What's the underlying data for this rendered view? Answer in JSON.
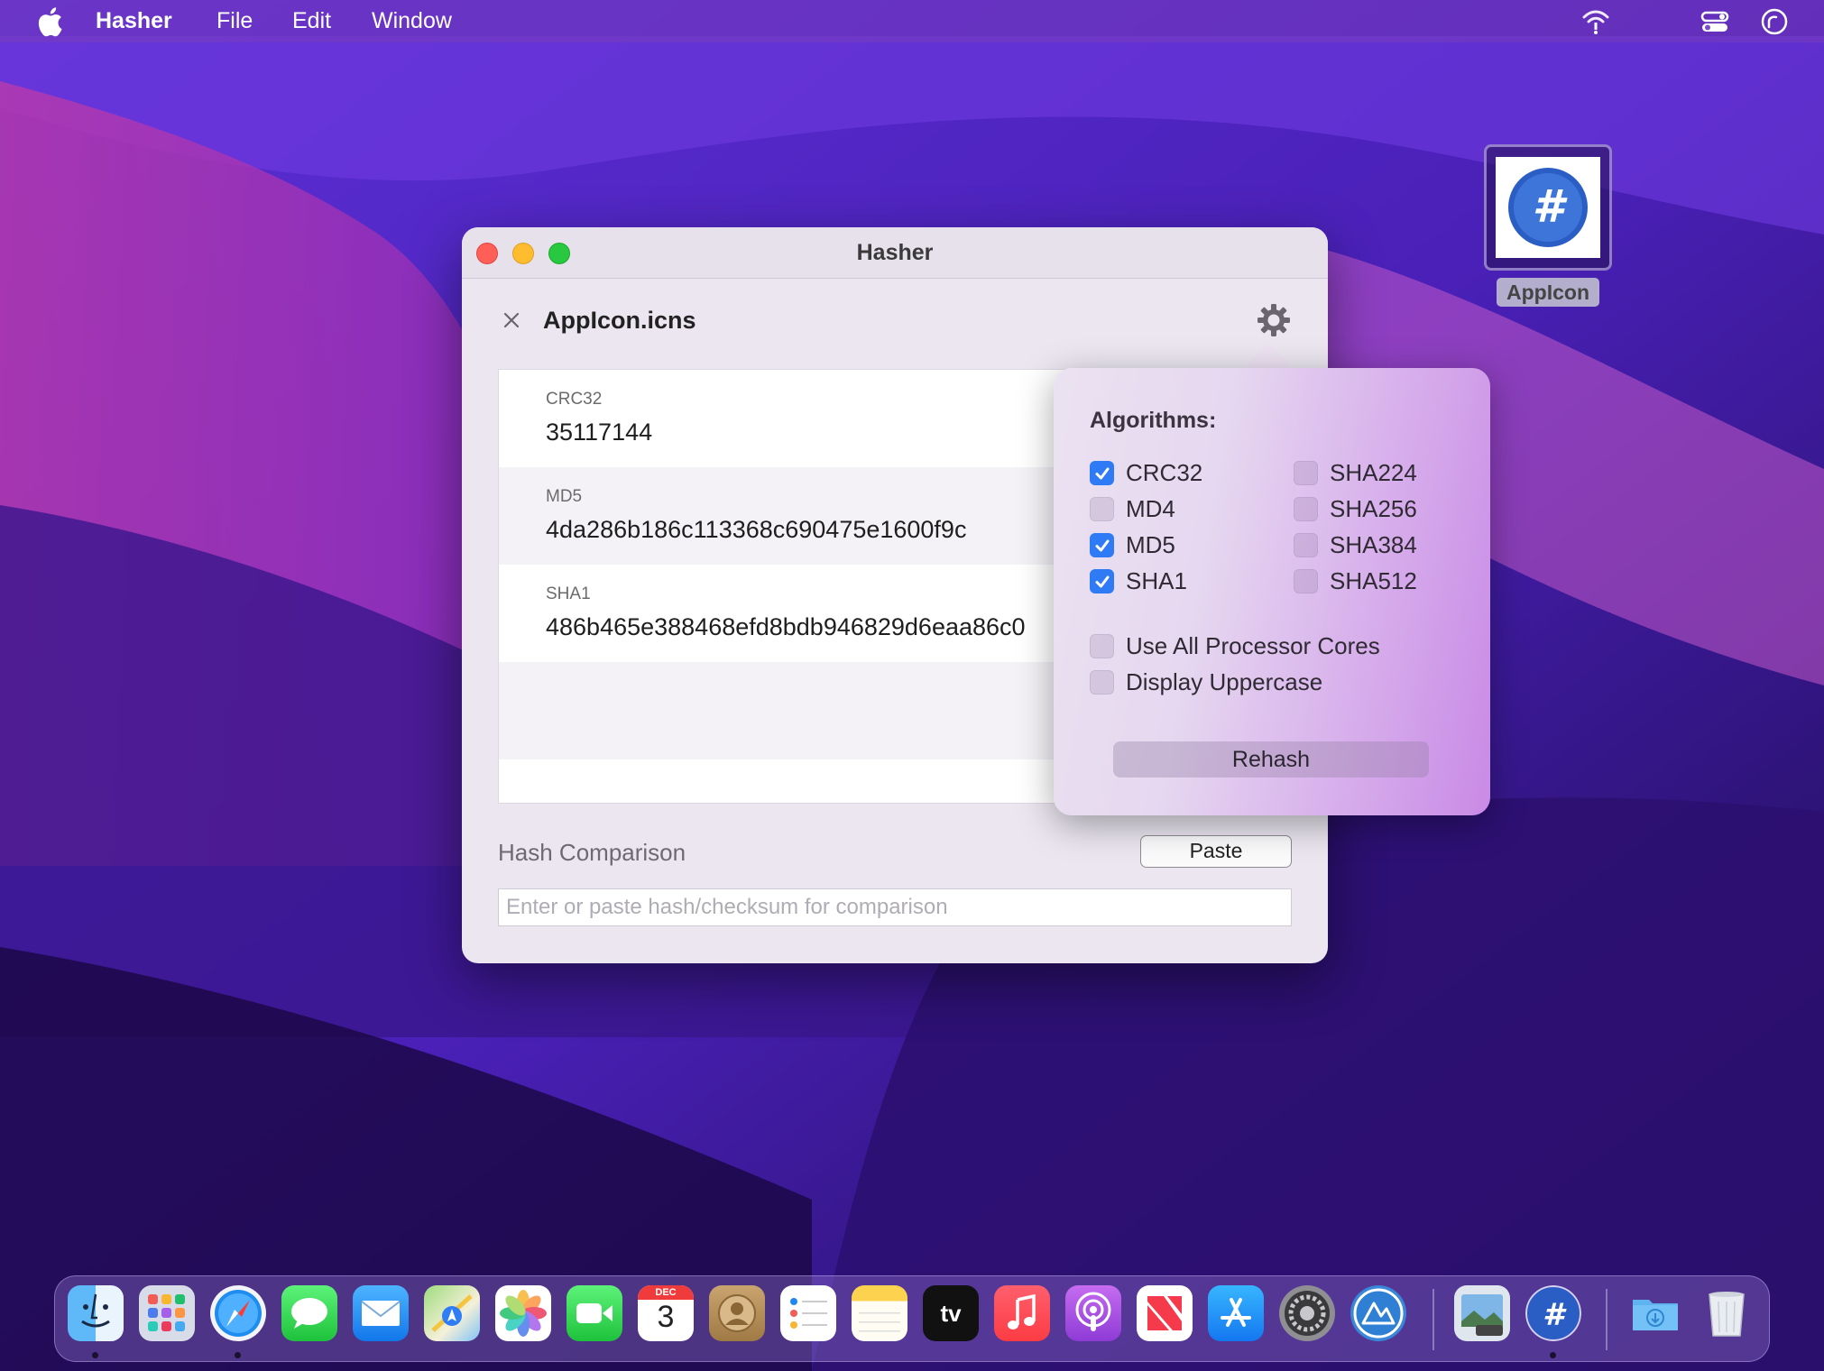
{
  "menubar": {
    "app_name": "Hasher",
    "menus": [
      "File",
      "Edit",
      "Window"
    ]
  },
  "desktop": {
    "icon_label": "AppIcon"
  },
  "window": {
    "title": "Hasher",
    "file_name": "AppIcon.icns",
    "hashes": [
      {
        "name": "CRC32",
        "value": "35117144"
      },
      {
        "name": "MD5",
        "value": "4da286b186c113368c690475e1600f9c"
      },
      {
        "name": "SHA1",
        "value": "486b465e388468efd8bdb946829d6eaa86c0"
      }
    ],
    "comparison": {
      "label": "Hash Comparison",
      "paste_label": "Paste",
      "placeholder": "Enter or paste hash/checksum for comparison",
      "value": ""
    }
  },
  "popover": {
    "title": "Algorithms:",
    "algorithms": [
      {
        "label": "CRC32",
        "checked": true
      },
      {
        "label": "MD4",
        "checked": false
      },
      {
        "label": "MD5",
        "checked": true
      },
      {
        "label": "SHA1",
        "checked": true
      },
      {
        "label": "SHA224",
        "checked": false
      },
      {
        "label": "SHA256",
        "checked": false
      },
      {
        "label": "SHA384",
        "checked": false
      },
      {
        "label": "SHA512",
        "checked": false
      }
    ],
    "options": [
      {
        "label": "Use All Processor Cores",
        "checked": false
      },
      {
        "label": "Display Uppercase",
        "checked": false
      }
    ],
    "rehash_label": "Rehash"
  },
  "dock": {
    "calendar_month": "DEC",
    "calendar_day": "3",
    "tv_label": "tv",
    "apps": [
      "finder",
      "launchpad",
      "safari",
      "messages",
      "mail",
      "maps",
      "photos",
      "facetime",
      "calendar",
      "contacts",
      "reminders",
      "notes",
      "apple-tv",
      "music",
      "podcasts",
      "news",
      "app-store",
      "system-preferences",
      "altstore",
      "preview",
      "hasher",
      "downloads",
      "trash"
    ]
  },
  "colors": {
    "accent_blue": "#2f7bf5",
    "traffic_red": "#fe5f57",
    "traffic_yellow": "#febc2e",
    "traffic_green": "#28c840"
  }
}
